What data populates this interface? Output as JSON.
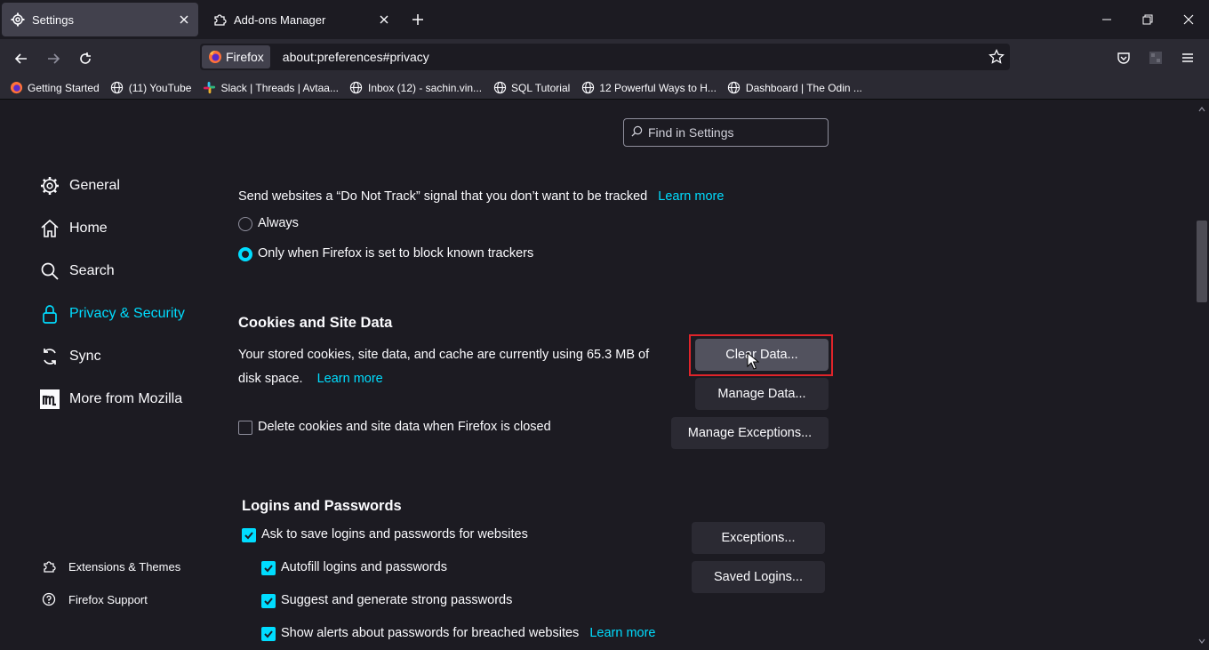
{
  "tabs": [
    {
      "label": "Settings",
      "icon": "gear-icon"
    },
    {
      "label": "Add-ons Manager",
      "icon": "puzzle-icon"
    }
  ],
  "urlbar": {
    "identity": "Firefox",
    "url": "about:preferences#privacy"
  },
  "bookmarks": [
    {
      "label": "Getting Started",
      "icon": "firefox-icon"
    },
    {
      "label": "(11) YouTube",
      "icon": "globe-icon"
    },
    {
      "label": "Slack | Threads | Avtaa...",
      "icon": "slack-icon"
    },
    {
      "label": "Inbox (12) - sachin.vin...",
      "icon": "globe-icon"
    },
    {
      "label": "SQL Tutorial",
      "icon": "globe-icon"
    },
    {
      "label": "12 Powerful Ways to H...",
      "icon": "globe-icon"
    },
    {
      "label": "Dashboard | The Odin ...",
      "icon": "globe-icon"
    }
  ],
  "search": {
    "placeholder": "Find in Settings"
  },
  "sidebar": {
    "categories": [
      {
        "label": "General",
        "icon": "gear-icon"
      },
      {
        "label": "Home",
        "icon": "home-icon"
      },
      {
        "label": "Search",
        "icon": "search-icon"
      },
      {
        "label": "Privacy & Security",
        "icon": "lock-icon",
        "selected": true
      },
      {
        "label": "Sync",
        "icon": "sync-icon"
      },
      {
        "label": "More from Mozilla",
        "icon": "mozilla-icon"
      }
    ],
    "footer": [
      {
        "label": "Extensions & Themes",
        "icon": "puzzle-icon"
      },
      {
        "label": "Firefox Support",
        "icon": "help-icon"
      }
    ]
  },
  "dnt": {
    "text": "Send websites a “Do Not Track” signal that you don’t want to be tracked",
    "learn_more": "Learn more",
    "options": [
      "Always",
      "Only when Firefox is set to block known trackers"
    ],
    "selected": 1
  },
  "cookies": {
    "heading": "Cookies and Site Data",
    "desc_line1": "Your stored cookies, site data, and cache are currently using 65.3 MB of",
    "desc_line2": "disk space.",
    "learn_more": "Learn more",
    "clear_button": "Clear Data...",
    "manage_button": "Manage Data...",
    "delete_checkbox": "Delete cookies and site data when Firefox is closed",
    "delete_checked": false,
    "exceptions_button": "Manage Exceptions..."
  },
  "logins": {
    "heading": "Logins and Passwords",
    "ask_save": "Ask to save logins and passwords for websites",
    "autofill": "Autofill logins and passwords",
    "suggest": "Suggest and generate strong passwords",
    "alerts": "Show alerts about passwords for breached websites",
    "learn_more": "Learn more",
    "exceptions_button": "Exceptions...",
    "saved_logins_button": "Saved Logins..."
  },
  "colors": {
    "accent": "#00ddff",
    "highlight": "#e0242a",
    "background": "#1c1b22"
  }
}
